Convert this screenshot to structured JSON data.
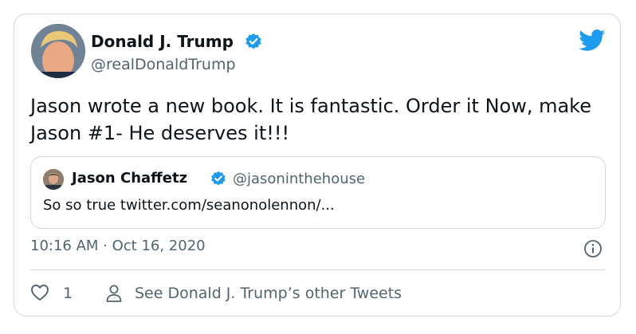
{
  "tweet": {
    "author_name": "Donald J. Trump",
    "author_handle": "@realDonaldTrump",
    "verified": true,
    "text": "Jason wrote a new book. It is fantastic. Order it Now, make Jason #1- He deserves it!!!",
    "timestamp": "10:16 AM · Oct 16, 2020",
    "like_count": "1",
    "see_more_label": "See Donald J. Trump’s other Tweets"
  },
  "quote": {
    "author_name": "Jason Chaffetz",
    "author_handle": "@jasoninthehouse",
    "verified": true,
    "text": "So so true twitter.com/seanonolennon/..."
  },
  "icons": {
    "logo": "twitter-bird-icon",
    "verified": "verified-badge-icon",
    "info": "info-icon",
    "like": "heart-icon",
    "profile": "person-icon"
  },
  "colors": {
    "twitter_blue": "#1d9bf0",
    "text_primary": "#0f1419",
    "text_secondary": "#536471",
    "border": "#cfd9de"
  }
}
